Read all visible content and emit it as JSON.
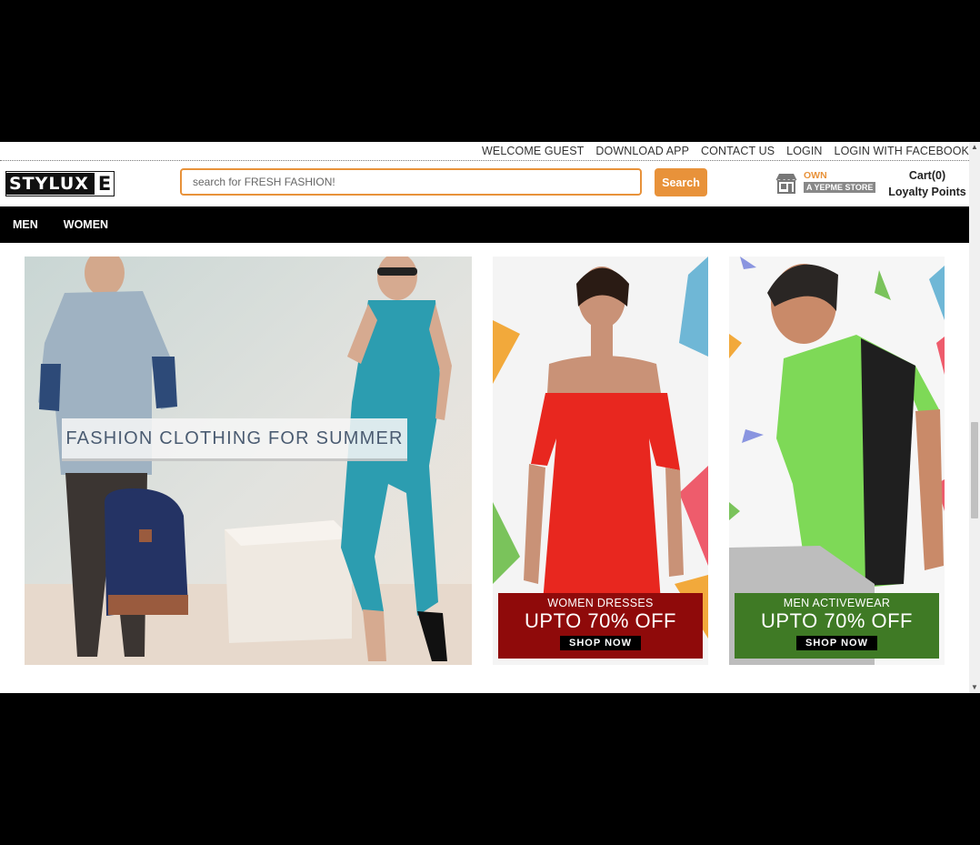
{
  "topbar": {
    "links": [
      "WELCOME GUEST",
      "DOWNLOAD APP",
      "CONTACT US",
      "LOGIN",
      "LOGIN WITH FACEBOOK"
    ]
  },
  "header": {
    "logo_main": "STYLUX",
    "logo_tail": "E",
    "search_placeholder": "search for FRESH FASHION!",
    "search_button": "Search",
    "own_label": "OWN",
    "own_sub": "A YEPME STORE",
    "cart_label": "Cart(0)",
    "loyalty_label": "Loyalty Points"
  },
  "nav": {
    "items": [
      "MEN",
      "WOMEN"
    ]
  },
  "banners": {
    "main_caption": "FASHION CLOTHING FOR SUMMER",
    "women": {
      "title": "WOMEN DRESSES",
      "offer": "UPTO 70% OFF",
      "cta": "SHOP NOW"
    },
    "men": {
      "title": "MEN ACTIVEWEAR",
      "offer": "UPTO 70% OFF",
      "cta": "SHOP NOW"
    }
  },
  "colors": {
    "accent": "#e8923a",
    "nav_bg": "#000000",
    "women_promo": "#8f0a0a",
    "men_promo": "#3f7a25"
  }
}
